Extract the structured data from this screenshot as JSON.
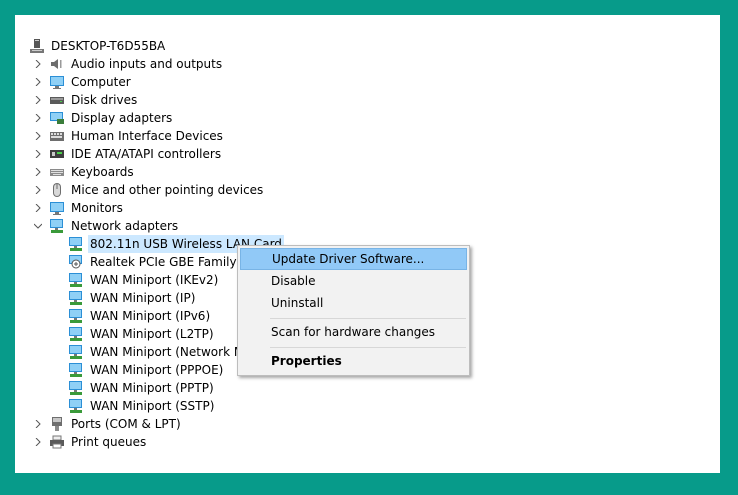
{
  "tree": {
    "root": {
      "label": "DESKTOP-T6D55BA",
      "icon": "computer-tower-icon"
    },
    "categories": [
      {
        "label": "Audio inputs and outputs",
        "icon": "speaker-icon",
        "expanded": false
      },
      {
        "label": "Computer",
        "icon": "monitor-icon",
        "expanded": false
      },
      {
        "label": "Disk drives",
        "icon": "disk-drive-icon",
        "expanded": false
      },
      {
        "label": "Display adapters",
        "icon": "display-adapter-icon",
        "expanded": false
      },
      {
        "label": "Human Interface Devices",
        "icon": "hid-icon",
        "expanded": false
      },
      {
        "label": "IDE ATA/ATAPI controllers",
        "icon": "ide-controller-icon",
        "expanded": false
      },
      {
        "label": "Keyboards",
        "icon": "keyboard-icon",
        "expanded": false
      },
      {
        "label": "Mice and other pointing devices",
        "icon": "mouse-icon",
        "expanded": false
      },
      {
        "label": "Monitors",
        "icon": "monitor-icon",
        "expanded": false
      },
      {
        "label": "Network adapters",
        "icon": "network-adapter-icon",
        "expanded": true
      },
      {
        "label": "Ports (COM & LPT)",
        "icon": "port-icon",
        "expanded": false
      },
      {
        "label": "Print queues",
        "icon": "printer-icon",
        "expanded": false
      }
    ],
    "network_children": [
      {
        "label": "802.11n USB Wireless LAN Card",
        "icon": "network-adapter-icon",
        "selected": true
      },
      {
        "label": "Realtek PCIe GBE Family Controller",
        "icon": "network-adapter-icon"
      },
      {
        "label": "WAN Miniport (IKEv2)",
        "icon": "network-adapter-icon"
      },
      {
        "label": "WAN Miniport (IP)",
        "icon": "network-adapter-icon"
      },
      {
        "label": "WAN Miniport (IPv6)",
        "icon": "network-adapter-icon"
      },
      {
        "label": "WAN Miniport (L2TP)",
        "icon": "network-adapter-icon"
      },
      {
        "label": "WAN Miniport (Network Monitor)",
        "icon": "network-adapter-icon"
      },
      {
        "label": "WAN Miniport (PPPOE)",
        "icon": "network-adapter-icon"
      },
      {
        "label": "WAN Miniport (PPTP)",
        "icon": "network-adapter-icon"
      },
      {
        "label": "WAN Miniport (SSTP)",
        "icon": "network-adapter-icon"
      }
    ]
  },
  "context_menu": {
    "items": [
      {
        "label": "Update Driver Software...",
        "highlighted": true
      },
      {
        "label": "Disable"
      },
      {
        "label": "Uninstall"
      },
      {
        "label": "Scan for hardware changes"
      },
      {
        "label": "Properties",
        "bold": true
      }
    ]
  },
  "colors": {
    "frame": "#079b8a",
    "selection": "#cce8ff",
    "menu_highlight": "#91c9f7"
  }
}
